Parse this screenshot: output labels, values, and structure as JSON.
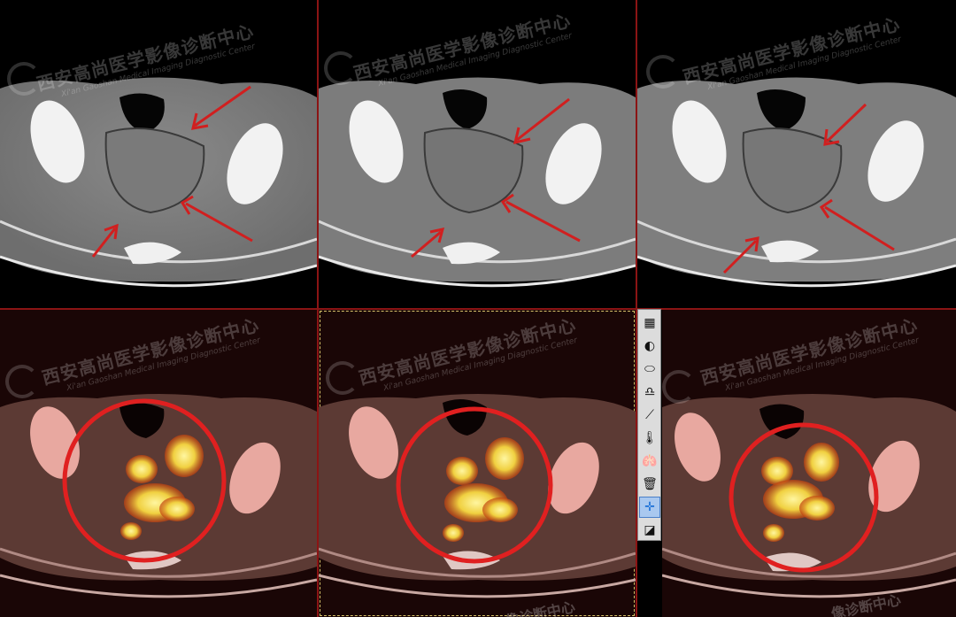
{
  "watermark": {
    "chinese": "西安高尚医学影像诊断中心",
    "english": "Xi'an Gaoshan Medical Imaging Diagnostic Center",
    "bottom_fragment": "像诊断中心"
  },
  "colors": {
    "separator": "#8b1414",
    "arrow": "#d11f1f",
    "circle": "#e02020",
    "active_border": "#d8c26a",
    "toolbar_bg": "#dcdcdc",
    "tool_selected": "#a9c8ef"
  },
  "toolbar": {
    "tools": [
      {
        "name": "window-level-icon",
        "glyph": "▦"
      },
      {
        "name": "contrast-icon",
        "glyph": "◐"
      },
      {
        "name": "ellipse-roi-icon",
        "glyph": "⬭"
      },
      {
        "name": "freehand-roi-icon",
        "glyph": "♎"
      },
      {
        "name": "line-measure-icon",
        "glyph": "⟋"
      },
      {
        "name": "thermometer-icon",
        "glyph": "🌡"
      },
      {
        "name": "lung-icon",
        "glyph": "🫁"
      },
      {
        "name": "trash-icon",
        "glyph": "🗑"
      },
      {
        "name": "crosshair-icon",
        "glyph": "✛"
      },
      {
        "name": "corner-resize-icon",
        "glyph": "◪"
      }
    ],
    "selected_index": 8
  }
}
